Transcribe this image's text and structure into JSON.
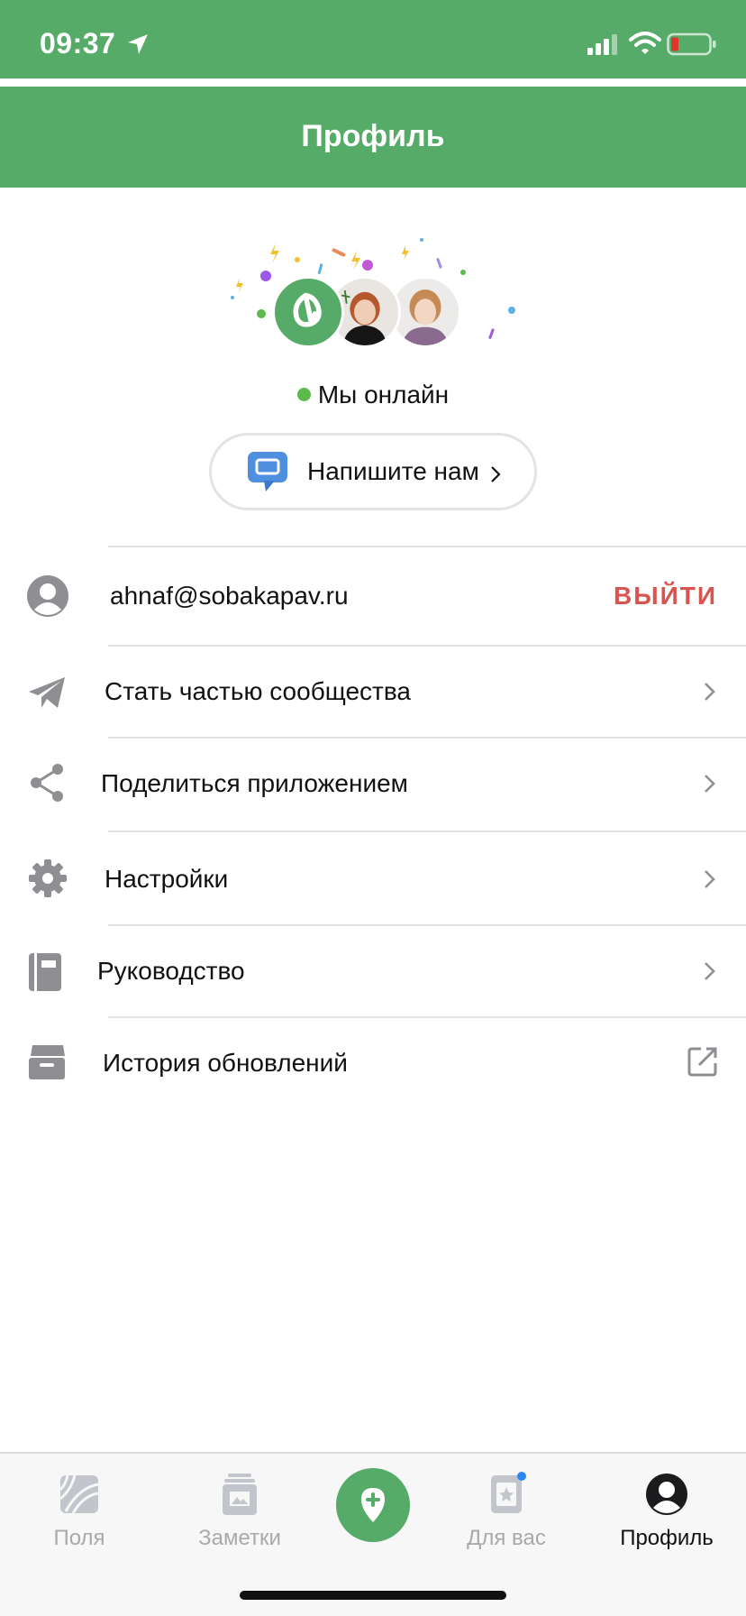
{
  "status_bar": {
    "time": "09:37"
  },
  "header": {
    "title": "Профиль"
  },
  "support": {
    "online_text": "Мы онлайн",
    "write_label": "Напишите нам"
  },
  "account": {
    "email": "ahnaf@sobakapav.ru",
    "logout": "ВЫЙТИ"
  },
  "menu": [
    {
      "label": "Стать частью сообщества",
      "icon": "paper-plane-icon"
    },
    {
      "label": "Поделиться приложением",
      "icon": "share-icon"
    },
    {
      "label": "Настройки",
      "icon": "gear-icon"
    },
    {
      "label": "Руководство",
      "icon": "book-icon"
    },
    {
      "label": "История обновлений",
      "icon": "archive-box-icon"
    }
  ],
  "tabs": [
    {
      "label": "Поля",
      "icon": "fields-icon"
    },
    {
      "label": "Заметки",
      "icon": "notes-icon"
    },
    {
      "label": "Для вас",
      "icon": "for-you-icon"
    },
    {
      "label": "Профиль",
      "icon": "profile-icon"
    }
  ],
  "colors": {
    "brand_green": "#57ab68",
    "logout_red": "#d9534f",
    "online_green": "#5cb94b",
    "tab_inactive": "#a9a9a9"
  }
}
